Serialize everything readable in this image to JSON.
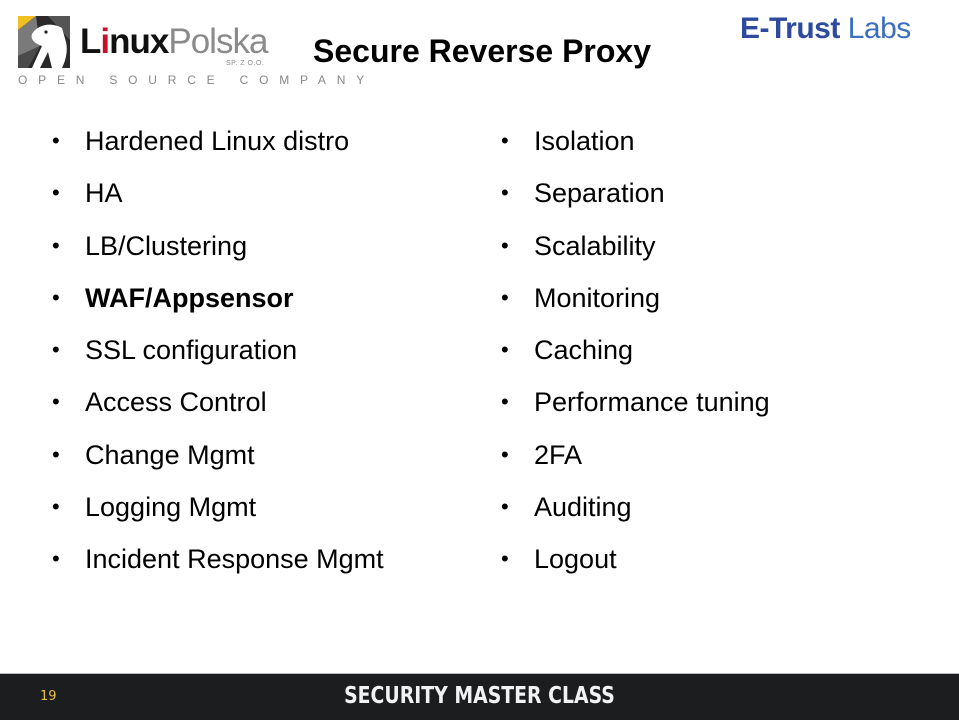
{
  "header": {
    "title": "Secure Reverse Proxy",
    "logo_left": {
      "name_bold": "Linux",
      "name_light": "Polska",
      "suffix": "SP. Z O.O.",
      "tagline": "OPEN SOURCE COMPANY",
      "accent_color": "#c8102e"
    },
    "logo_right": {
      "name_bold": "E-Trust",
      "name_light": "Labs",
      "color_primary": "#2d4a9e",
      "color_secondary": "#3b6ec0"
    }
  },
  "content": {
    "bullet_glyph": "•",
    "left_column": [
      {
        "text": "Hardened Linux distro",
        "bold": false
      },
      {
        "text": "HA",
        "bold": false
      },
      {
        "text": "LB/Clustering",
        "bold": false
      },
      {
        "text": "WAF/Appsensor",
        "bold": true
      },
      {
        "text": "SSL configuration",
        "bold": false
      },
      {
        "text": "Access Control",
        "bold": false
      },
      {
        "text": "Change Mgmt",
        "bold": false
      },
      {
        "text": "Logging Mgmt",
        "bold": false
      },
      {
        "text": "Incident Response Mgmt",
        "bold": false
      }
    ],
    "right_column": [
      {
        "text": "Isolation",
        "bold": false
      },
      {
        "text": "Separation",
        "bold": false
      },
      {
        "text": "Scalability",
        "bold": false
      },
      {
        "text": "Monitoring",
        "bold": false
      },
      {
        "text": "Caching",
        "bold": false
      },
      {
        "text": "Performance tuning",
        "bold": false
      },
      {
        "text": "2FA",
        "bold": false
      },
      {
        "text": "Auditing",
        "bold": false
      },
      {
        "text": "Logout",
        "bold": false
      }
    ]
  },
  "footer": {
    "page_number": "19",
    "brand": "SECURITY MASTER CLASS",
    "background": "#1c1d1f",
    "page_number_color": "#e8c040"
  }
}
